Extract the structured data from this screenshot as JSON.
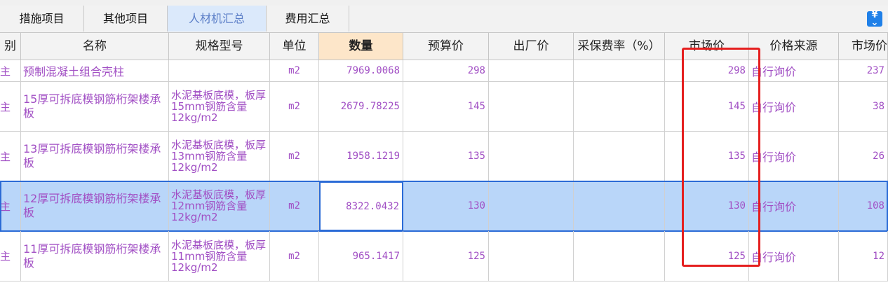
{
  "tabs": [
    {
      "label": "措施项目"
    },
    {
      "label": "其他项目"
    },
    {
      "label": "人材机汇总",
      "active": true
    },
    {
      "label": "费用汇总"
    }
  ],
  "toolbar_icon": "currency-yen-icon",
  "columns": [
    "别",
    "名称",
    "规格型号",
    "单位",
    "数量",
    "预算价",
    "出厂价",
    "采保费率（%）",
    "市场价",
    "价格来源",
    "市场价"
  ],
  "rows": [
    {
      "type": "主",
      "name": "预制混凝土组合壳柱",
      "spec": "",
      "unit": "m2",
      "qty": "7969.0068",
      "budget": "298",
      "factory": "",
      "rate": "",
      "market": "298",
      "source": "自行询价",
      "market2": "237"
    },
    {
      "type": "主",
      "name": "15厚可拆底模钢筋桁架楼承板",
      "spec": "水泥基板底模，板厚15mm钢筋含量12kg/m2",
      "unit": "m2",
      "qty": "2679.78225",
      "budget": "145",
      "factory": "",
      "rate": "",
      "market": "145",
      "source": "自行询价",
      "market2": "38"
    },
    {
      "type": "主",
      "name": "13厚可拆底模钢筋桁架楼承板",
      "spec": "水泥基板底模，板厚13mm钢筋含量12kg/m2",
      "unit": "m2",
      "qty": "1958.1219",
      "budget": "135",
      "factory": "",
      "rate": "",
      "market": "135",
      "source": "自行询价",
      "market2": "26"
    },
    {
      "type": "主",
      "name": "12厚可拆底模钢筋桁架楼承板",
      "spec": "水泥基板底模，板厚12mm钢筋含量12kg/m2",
      "unit": "m2",
      "qty": "8322.0432",
      "budget": "130",
      "factory": "",
      "rate": "",
      "market": "130",
      "source": "自行询价",
      "market2": "108",
      "selected": true
    },
    {
      "type": "主",
      "name": "11厚可拆底模钢筋桁架楼承板",
      "spec": "水泥基板底模，板厚11mm钢筋含量12kg/m2",
      "unit": "m2",
      "qty": "965.1417",
      "budget": "125",
      "factory": "",
      "rate": "",
      "market": "125",
      "source": "自行询价",
      "market2": "12"
    }
  ]
}
